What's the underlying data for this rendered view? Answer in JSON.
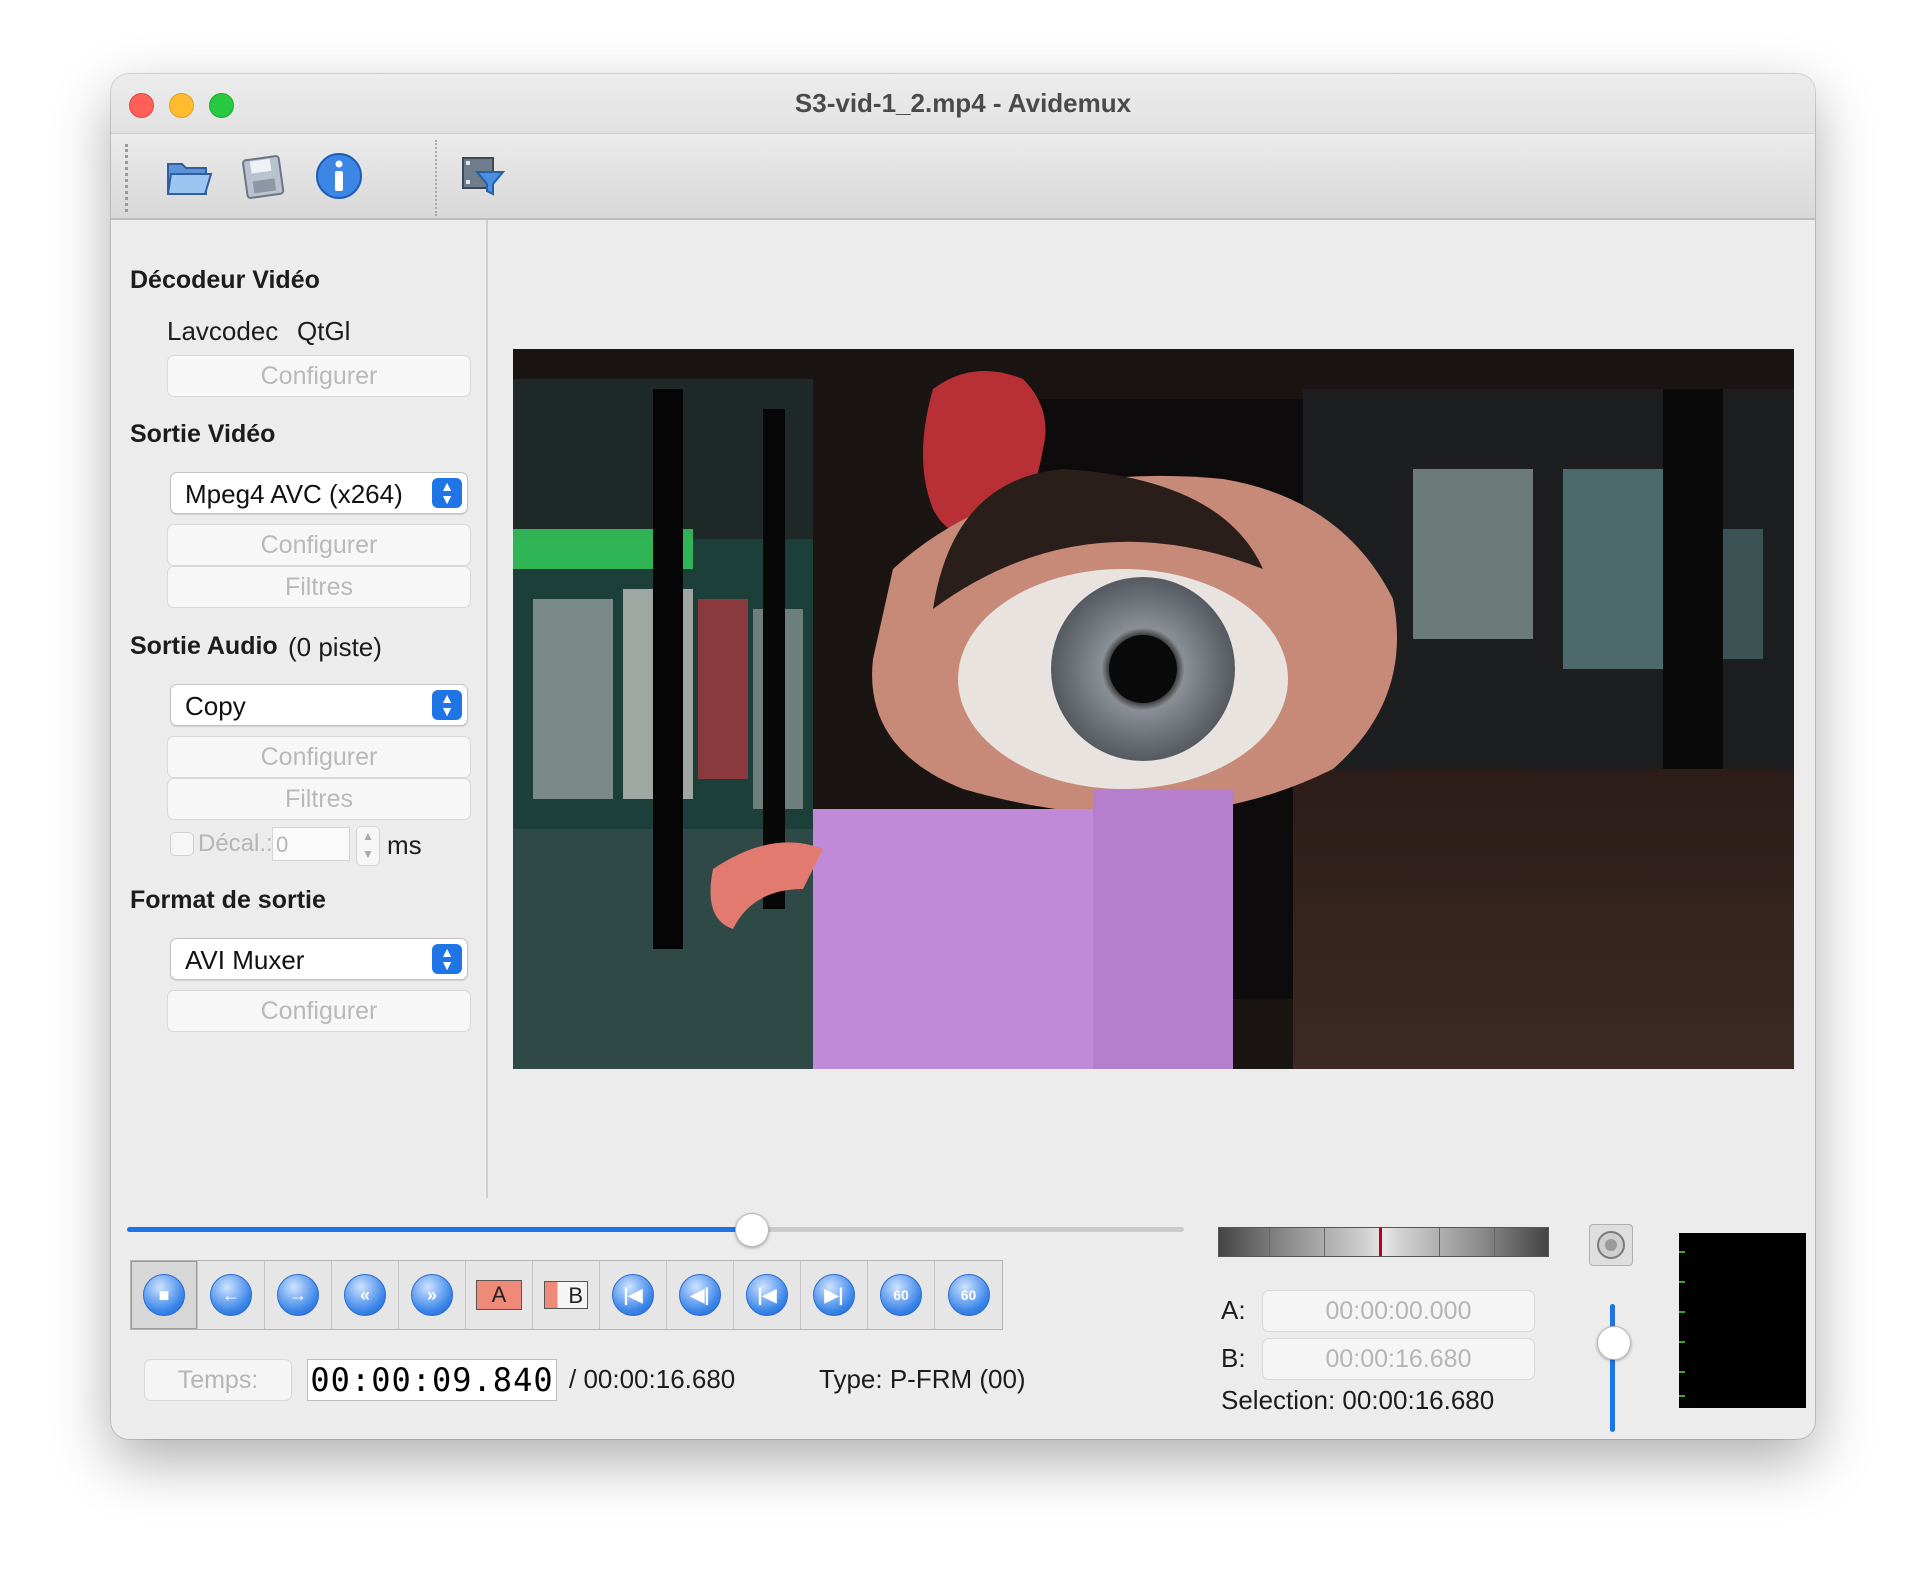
{
  "window": {
    "title": "S3-vid-1_2.mp4 - Avidemux"
  },
  "toolbar": {
    "icons": [
      "open-folder-icon",
      "save-floppy-icon",
      "info-icon",
      "film-filter-icon"
    ]
  },
  "left_panel": {
    "decoder": {
      "heading": "Décodeur Vidéo",
      "name1": "Lavcodec",
      "name2": "QtGl",
      "configure": "Configurer"
    },
    "video_out": {
      "heading": "Sortie Vidéo",
      "codec": "Mpeg4 AVC (x264)",
      "configure": "Configurer",
      "filters": "Filtres"
    },
    "audio_out": {
      "heading": "Sortie Audio",
      "tracks": "(0 piste)",
      "codec": "Copy",
      "configure": "Configurer",
      "filters": "Filtres",
      "offset_label": "Décal.:",
      "offset_value": "0",
      "offset_unit": "ms"
    },
    "format": {
      "heading": "Format de sortie",
      "muxer": "AVI Muxer",
      "configure": "Configurer"
    }
  },
  "playback": {
    "position_fraction": 0.59,
    "controls": [
      "stop-icon",
      "prev-frame-icon",
      "next-frame-icon",
      "rewind-keyframe-icon",
      "forward-keyframe-icon",
      "marker-a-icon",
      "marker-b-icon",
      "goto-start-icon",
      "goto-marker-a-icon",
      "goto-marker-b-icon",
      "goto-end-icon",
      "back-60-icon",
      "forward-60-icon"
    ],
    "marker_a_glyph": "A",
    "marker_b_glyph": "B",
    "jump_glyph": "60",
    "time_label": "Temps:",
    "current_time": "00:00:09.840",
    "total_time": "/ 00:00:16.680",
    "frame_type": "Type:  P-FRM (00)"
  },
  "selection": {
    "a_label": "A:",
    "a_value": "00:00:00.000",
    "b_label": "B:",
    "b_value": "00:00:16.680",
    "selection_text": "Selection: 00:00:16.680"
  },
  "volume": {
    "level_fraction": 0.7
  },
  "colors": {
    "accent": "#1f74e6",
    "window_bg": "#ececec"
  }
}
